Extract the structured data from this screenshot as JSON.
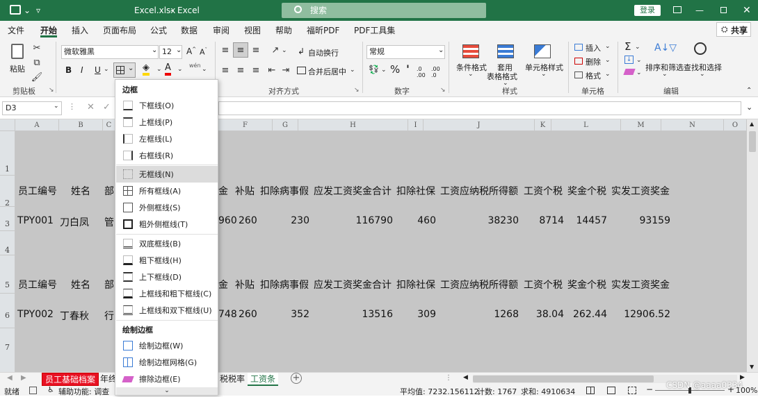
{
  "titlebar": {
    "filename": "Excel.xlsx",
    "separator": "-",
    "app": "Excel",
    "search_placeholder": "搜索",
    "login": "登录"
  },
  "ribbon_tabs": [
    "文件",
    "开始",
    "插入",
    "页面布局",
    "公式",
    "数据",
    "审阅",
    "视图",
    "帮助",
    "福昕PDF",
    "PDF工具集"
  ],
  "share": "共享",
  "clipboard": {
    "paste": "粘贴",
    "group": "剪贴板"
  },
  "font": {
    "name": "微软雅黑",
    "size": "12",
    "bold": "B",
    "italic": "I",
    "underline": "U",
    "wen": "wén"
  },
  "alignment": {
    "wrap": "自动换行",
    "merge": "合并后居中",
    "group": "对齐方式"
  },
  "number": {
    "format": "常规",
    "group": "数字"
  },
  "styles": {
    "cond": "条件格式",
    "table1": "套用",
    "table2": "表格格式",
    "cell": "单元格样式",
    "group": "样式"
  },
  "cells": {
    "insert": "插入",
    "delete": "删除",
    "format": "格式",
    "group": "单元格"
  },
  "editing": {
    "sort": "排序和筛选",
    "find": "查找和选择",
    "group": "编辑"
  },
  "formula": {
    "namebox": "D3",
    "fx": "fx"
  },
  "columns": [
    "A",
    "B",
    "C",
    "D",
    "E",
    "F",
    "G",
    "H",
    "I",
    "J",
    "K",
    "L",
    "M",
    "N",
    "O"
  ],
  "rows": [
    "1",
    "2",
    "3",
    "4",
    "5",
    "6",
    "7"
  ],
  "header": [
    "员工编号",
    "姓名",
    "部",
    "金",
    "补贴",
    "扣除病事假",
    "应发工资奖金合计",
    "扣除社保",
    "工资应纳税所得额",
    "工资个税",
    "奖金个税",
    "实发工资奖金"
  ],
  "record1": {
    "id": "TPY001",
    "name": "刀白凤",
    "dept": "管",
    "d": "960",
    "sub": "260",
    "leave": "230",
    "total": "116790",
    "ss": "460",
    "taxable": "38230",
    "tax": "8714",
    "btax": "14457",
    "net": "93159"
  },
  "record2": {
    "id": "TPY002",
    "name": "丁春秋",
    "dept": "行",
    "d": "748",
    "sub": "260",
    "leave": "352",
    "total": "13516",
    "ss": "309",
    "taxable": "1268",
    "tax": "38.04",
    "btax": "262.44",
    "net": "12906.52"
  },
  "sheets": [
    "员工基础档案",
    "年终",
    "税税率",
    "工资条"
  ],
  "status": {
    "ready": "就绪",
    "access": "辅助功能: 调查",
    "avg": "平均值: 7232.156112",
    "count": "计数: 1767",
    "sum": "求和: 4910634",
    "zoom": "100%",
    "watermark": "CSDN @aaaa0334"
  },
  "menu": {
    "title1": "边框",
    "items1": [
      "下框线(O)",
      "上框线(P)",
      "左框线(L)",
      "右框线(R)"
    ],
    "items2": [
      "无框线(N)",
      "所有框线(A)",
      "外侧框线(S)",
      "粗外侧框线(T)"
    ],
    "items3": [
      "双底框线(B)",
      "粗下框线(H)",
      "上下框线(D)",
      "上框线和粗下框线(C)",
      "上框线和双下框线(U)"
    ],
    "title2": "绘制边框",
    "items4": [
      "绘制边框(W)",
      "绘制边框网格(G)",
      "擦除边框(E)"
    ]
  },
  "colors": {
    "excel_green": "#217346",
    "grid_gray": "#c6c6c6",
    "sheet_red": "#e81123",
    "menu_highlight": "#dcdcdc"
  }
}
